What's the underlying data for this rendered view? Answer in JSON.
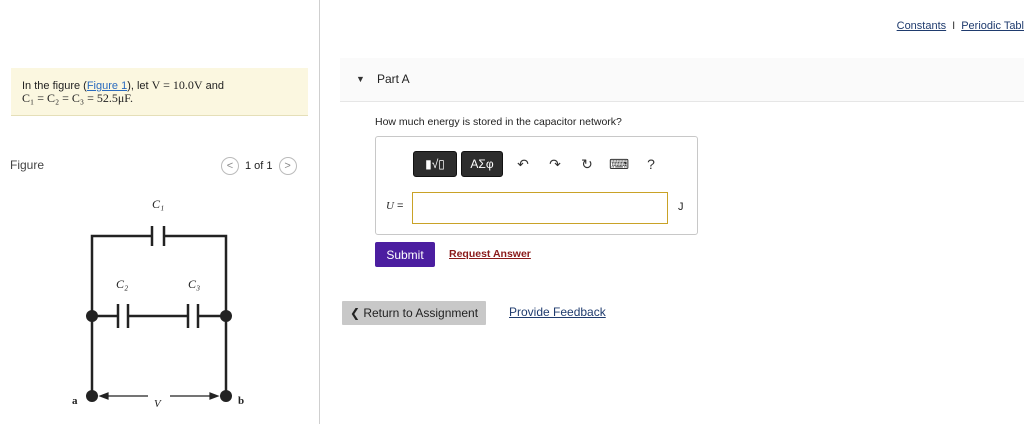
{
  "problem": {
    "prefix": "In the figure (",
    "link": "Figure 1",
    "suffix": "), let ",
    "voltage": "V = 10.0V",
    "and": " and",
    "capacitance": "C₁ = C₂ = C₃ = 52.5μF."
  },
  "figure": {
    "label": "Figure",
    "pager": "1 of 1",
    "prev": "<",
    "next": ">",
    "labels": {
      "c1": "C₁",
      "c2": "C₂",
      "c3": "C₃",
      "a": "a",
      "b": "b",
      "v": "V"
    }
  },
  "header": {
    "constants": "Constants",
    "separator": "I",
    "periodic": "Periodic Tabl"
  },
  "part": {
    "title": "Part A"
  },
  "question": "How much energy is stored in the capacitor network?",
  "toolbar": {
    "template_btn": "▮√▯",
    "greek_btn": "ΑΣφ",
    "undo": "↶",
    "redo": "↷",
    "reset": "↻",
    "keyboard": "⌨",
    "help": "?"
  },
  "answer": {
    "variable": "U",
    "equals": " =",
    "value": "",
    "unit": "J"
  },
  "buttons": {
    "submit": "Submit",
    "request": "Request Answer",
    "return": "❮ Return to Assignment",
    "feedback": "Provide Feedback"
  },
  "colors": {
    "submit": "#4b1ea0",
    "problem_bg": "#fbf7e0",
    "input_border": "#c9a227"
  }
}
